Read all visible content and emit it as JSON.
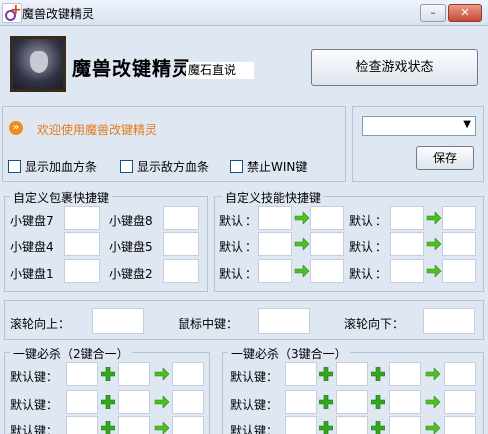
{
  "window": {
    "title": "魔兽改键精灵",
    "minimize": "–",
    "close": "✕"
  },
  "header": {
    "app_title": "魔兽改键精灵",
    "subtitle": "魔石直说",
    "check_button": "检查游戏状态"
  },
  "welcome": {
    "icon": "»",
    "text": "欢迎使用魔兽改键精灵"
  },
  "options": {
    "show_ally_hp": "显示加血方条",
    "show_enemy_hp": "显示敌方血条",
    "disable_win": "禁止WIN键"
  },
  "select": {
    "value": "",
    "arrow": "▼"
  },
  "save_button": "保存",
  "inventory": {
    "legend": "自定义包裹快捷键",
    "labels": [
      "小键盘7",
      "小键盘8",
      "小键盘4",
      "小键盘5",
      "小键盘1",
      "小键盘2"
    ]
  },
  "skills": {
    "legend": "自定义技能快捷键",
    "default_label": "默认",
    "colon": "："
  },
  "wheel": {
    "up": "滚轮向上：",
    "middle": "鼠标中键：",
    "down": "滚轮向下："
  },
  "combo2": {
    "legend": "一键必杀（2键合一）",
    "default_key": "默认键："
  },
  "combo3": {
    "legend": "一键必杀（3键合一）",
    "default_key": "默认键："
  },
  "colors": {
    "accent_orange": "#e57a17",
    "arrow_green": "#4fbf26",
    "plus_green": "#31a81e"
  }
}
